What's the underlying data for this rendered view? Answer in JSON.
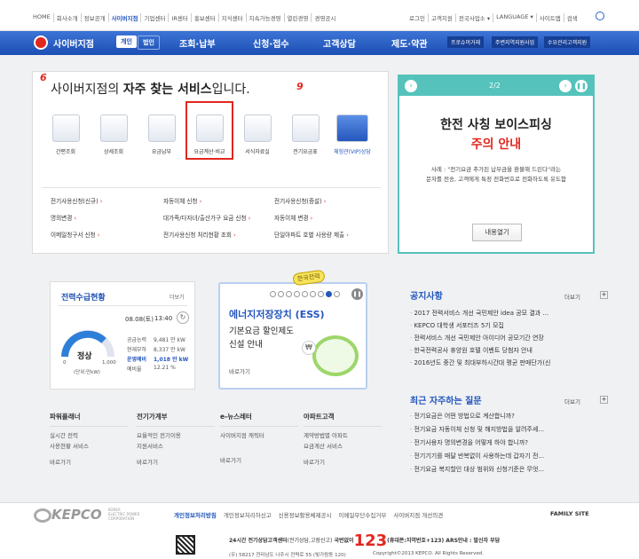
{
  "util_nav": {
    "left": [
      "HOME",
      "회사소개",
      "정보공개",
      "사이버지점",
      "기업센터",
      "IR센터",
      "홍보센터",
      "지식센터",
      "지속가능경영",
      "열린경영",
      "경영공시"
    ],
    "right": [
      "로그인",
      "고객지원",
      "전국사업소 ▾",
      "LANGUAGE ▾",
      "사이트맵",
      "검색"
    ]
  },
  "gnb": {
    "brand": "사이버지점",
    "tab_personal": "개인",
    "tab_corporate": "법인",
    "menus": [
      "조회·납부",
      "신청·접수",
      "고객상담",
      "제도·약관"
    ],
    "quick": [
      "프로슈머거래",
      "주변지역지원사업",
      "수요관리고객지원"
    ]
  },
  "services": {
    "title_pre": "사이버지점의 ",
    "title_bold": "자주 찾는 서비스",
    "title_post": "입니다.",
    "mark_6": "6",
    "mark_9": "9",
    "icons": [
      "간편조회",
      "상세조회",
      "요금납부",
      "요금계산·비교",
      "서식자료실",
      "전기요금표",
      "체험관(VIP)상담"
    ],
    "links": [
      "전기사용신청(신규)",
      "자동이체 신청",
      "전기사용신청(증설)",
      "명의변경",
      "대가족/다자녀/출산가구 요금 신청",
      "자동이체 변경",
      "이메일청구서 신청",
      "전기사용신청 처리현황 조회",
      "단일아파트 호별 사용량 제출"
    ]
  },
  "banner": {
    "page": "2/2",
    "title": "한전 사칭 보이스피싱",
    "subtitle": "주의 안내",
    "desc_line1": "사례 : \"전기요금 추가된 납부금을 환불해 드린다\"라는",
    "desc_line2": "문자를 전송, 고객에게 특정 전화번호로 전화하도록 유도함",
    "button": "내용열기"
  },
  "supply": {
    "title": "전력수급현황",
    "more": "더보기",
    "datetime_date": "08.08(토)",
    "datetime_time": "13:40",
    "status": "정상",
    "gauge_min": "0",
    "gauge_max": "1,000",
    "unit": "(단위:만kW)",
    "rows": [
      {
        "label": "공급능력",
        "value": "9,481 만 kW"
      },
      {
        "label": "현재부하",
        "value": "8,337 만 kW"
      },
      {
        "label": "운영예비",
        "value": "1,018 만 kW"
      },
      {
        "label": "예비율",
        "value": "12.21 %"
      }
    ]
  },
  "ess": {
    "title": "에너지저장장치 (ESS)",
    "line1": "기본요금 할인제도",
    "line2": "신설 안내",
    "more": "바로가기",
    "sticker": "한국전력"
  },
  "notice": {
    "title": "공지사항",
    "more": "더보기",
    "items": [
      "2017 전력서비스 개선 국민제안 idea 공모 결과 ...",
      "KEPCO 대학생 서포터즈 5기 모집",
      "전력서비스 개선 국민제안 아이디어 공모기간 연장",
      "한국전력공사 휴양원 호텔 이벤트 당첨자 안내",
      "2016년도 중간 및 최대부하시간대 평균 판매단가(신"
    ]
  },
  "faq": {
    "title": "최근 자주하는 질문",
    "more": "더보기",
    "items": [
      "전기요금은 어떤 방법으로 계산합니까?",
      "전기요금 자동이체 신청 및 해지방법을 알려주세...",
      "전기사용자 명의변경을 어떻게 하야 합니까?",
      "전기기기를 매달 반복없이 사용하는데 갑자기 전...",
      "전기요금 복지할인 대상 범위와 신청기준은 무엇..."
    ]
  },
  "shortcuts": [
    {
      "title": "파워플래너",
      "desc1": "실시간 전력",
      "desc2": "사용현황 서비스",
      "more": "바로가기"
    },
    {
      "title": "전기가계부",
      "desc1": "요율적인 전기이용",
      "desc2": "지원서비스",
      "more": "바로가기"
    },
    {
      "title": "e-뉴스레터",
      "desc1": "사이버지점 캐릭터",
      "desc2": "",
      "more": "바로가기"
    },
    {
      "title": "아파트고객",
      "desc1": "계약방법별 아파트",
      "desc2": "요금계산 서비스",
      "more": "바로가기"
    }
  ],
  "footer": {
    "logo": "KEPCO",
    "logo_sub1": "KOREA",
    "logo_sub2": "ELECTRIC POWER",
    "logo_sub3": "CORPORATION",
    "links": [
      "개인정보처리방침",
      "개인정보처리하신고",
      "신용정보활용체제공시",
      "이메일무단수집거부",
      "사이버지점 개선의견"
    ],
    "family": "FAMILY SITE",
    "call_pre": "24시간 전기상담고객센터",
    "call_paren": "(전기상담,고장신고)",
    "call_mid": " 국번없이",
    "call_num": "123",
    "call_post": "(휴대폰:지역번호+123) ARS안내 : 발신자 부담",
    "address": "(우) 58217 전라남도 나주시 전력로 55 (빛가람동 120)",
    "copyright": "Copyright©2013 KEPCO. All Rights Reserved."
  }
}
